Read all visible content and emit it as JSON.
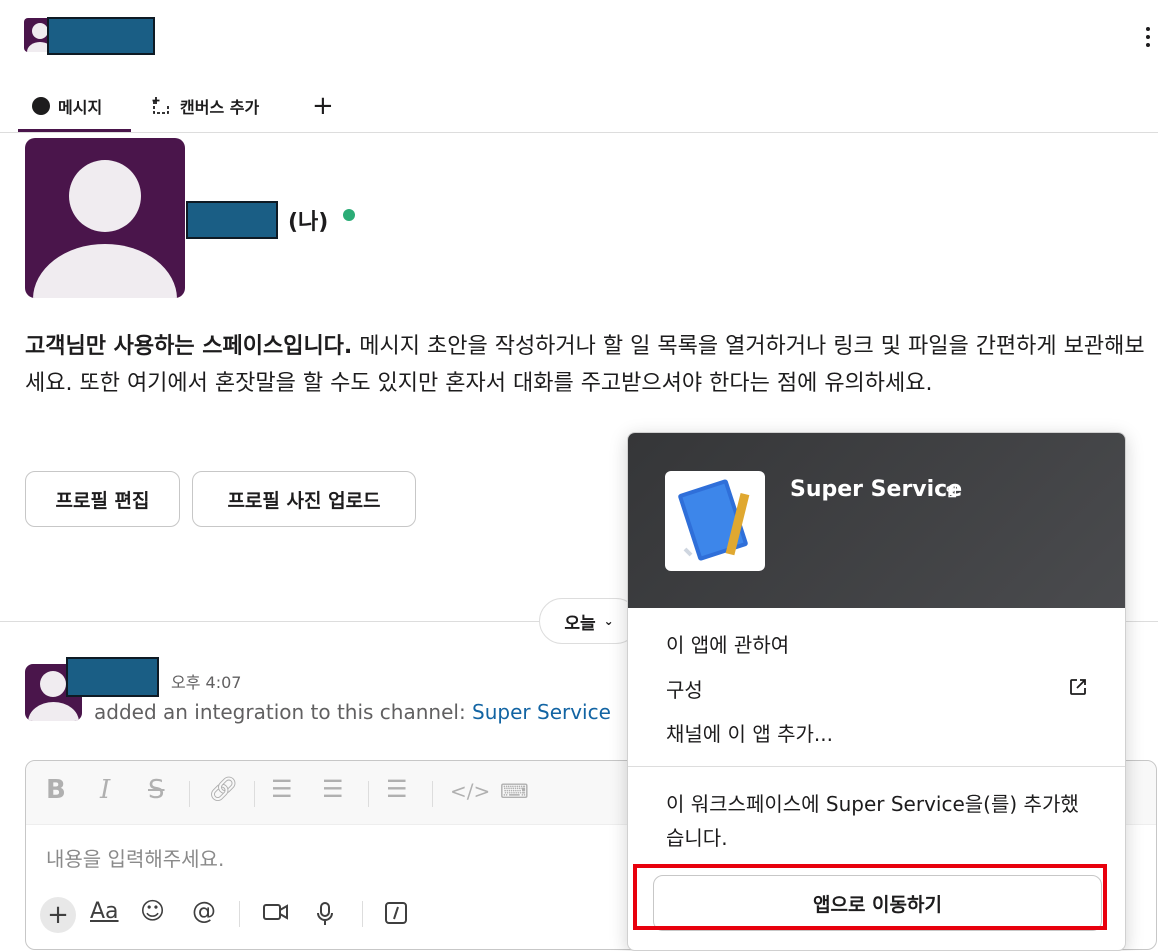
{
  "header": {
    "redacted_name": ""
  },
  "tabs": [
    {
      "label": "메시지"
    },
    {
      "label": "캔버스 추가"
    },
    {
      "label": "+"
    }
  ],
  "profile": {
    "me_label": "(나)",
    "intro_bold": "고객님만 사용하는 스페이스입니다.",
    "intro_text": " 메시지 초안을 작성하거나 할 일 목록을 열거하거나 링크 및 파일을 간편하게 보관해보세요. 또한 여기에서 혼잣말을 할 수도 있지만 혼자서 대화를 주고받으셔야 한다는 점에 유의하세요.",
    "edit_button": "프로필 편집",
    "upload_button": "프로필 사진 업로드"
  },
  "date_divider": {
    "label": "오늘"
  },
  "message": {
    "time": "오후 4:07",
    "text": "added an integration to this channel: ",
    "link": "Super Service"
  },
  "composer": {
    "placeholder": "내용을 입력해주세요."
  },
  "popup": {
    "app_name": "Super Service",
    "app_badge": "앱",
    "menu": [
      {
        "label": "이 앱에 관하여"
      },
      {
        "label": "구성"
      },
      {
        "label": "채널에 이 앱 추가..."
      }
    ],
    "note": "이 워크스페이스에 Super Service을(를) 추가했습니다.",
    "goto_button": "앱으로 이동하기"
  },
  "colors": {
    "brand": "#4a154b",
    "online": "#2bac76",
    "link": "#1264a3",
    "highlight": "#e8000d",
    "redaction": "#1a5e85"
  },
  "icons": [
    "kebab-icon",
    "message-bubble-icon",
    "canvas-add-icon",
    "plus-icon",
    "chevron-down-icon",
    "bold-icon",
    "italic-icon",
    "strikethrough-icon",
    "link-icon",
    "ordered-list-icon",
    "bullet-list-icon",
    "blockquote-icon",
    "code-icon",
    "code-block-icon",
    "text-format-icon",
    "emoji-icon",
    "mention-icon",
    "video-icon",
    "microphone-icon",
    "slash-command-icon",
    "external-link-icon",
    "app-icon"
  ]
}
